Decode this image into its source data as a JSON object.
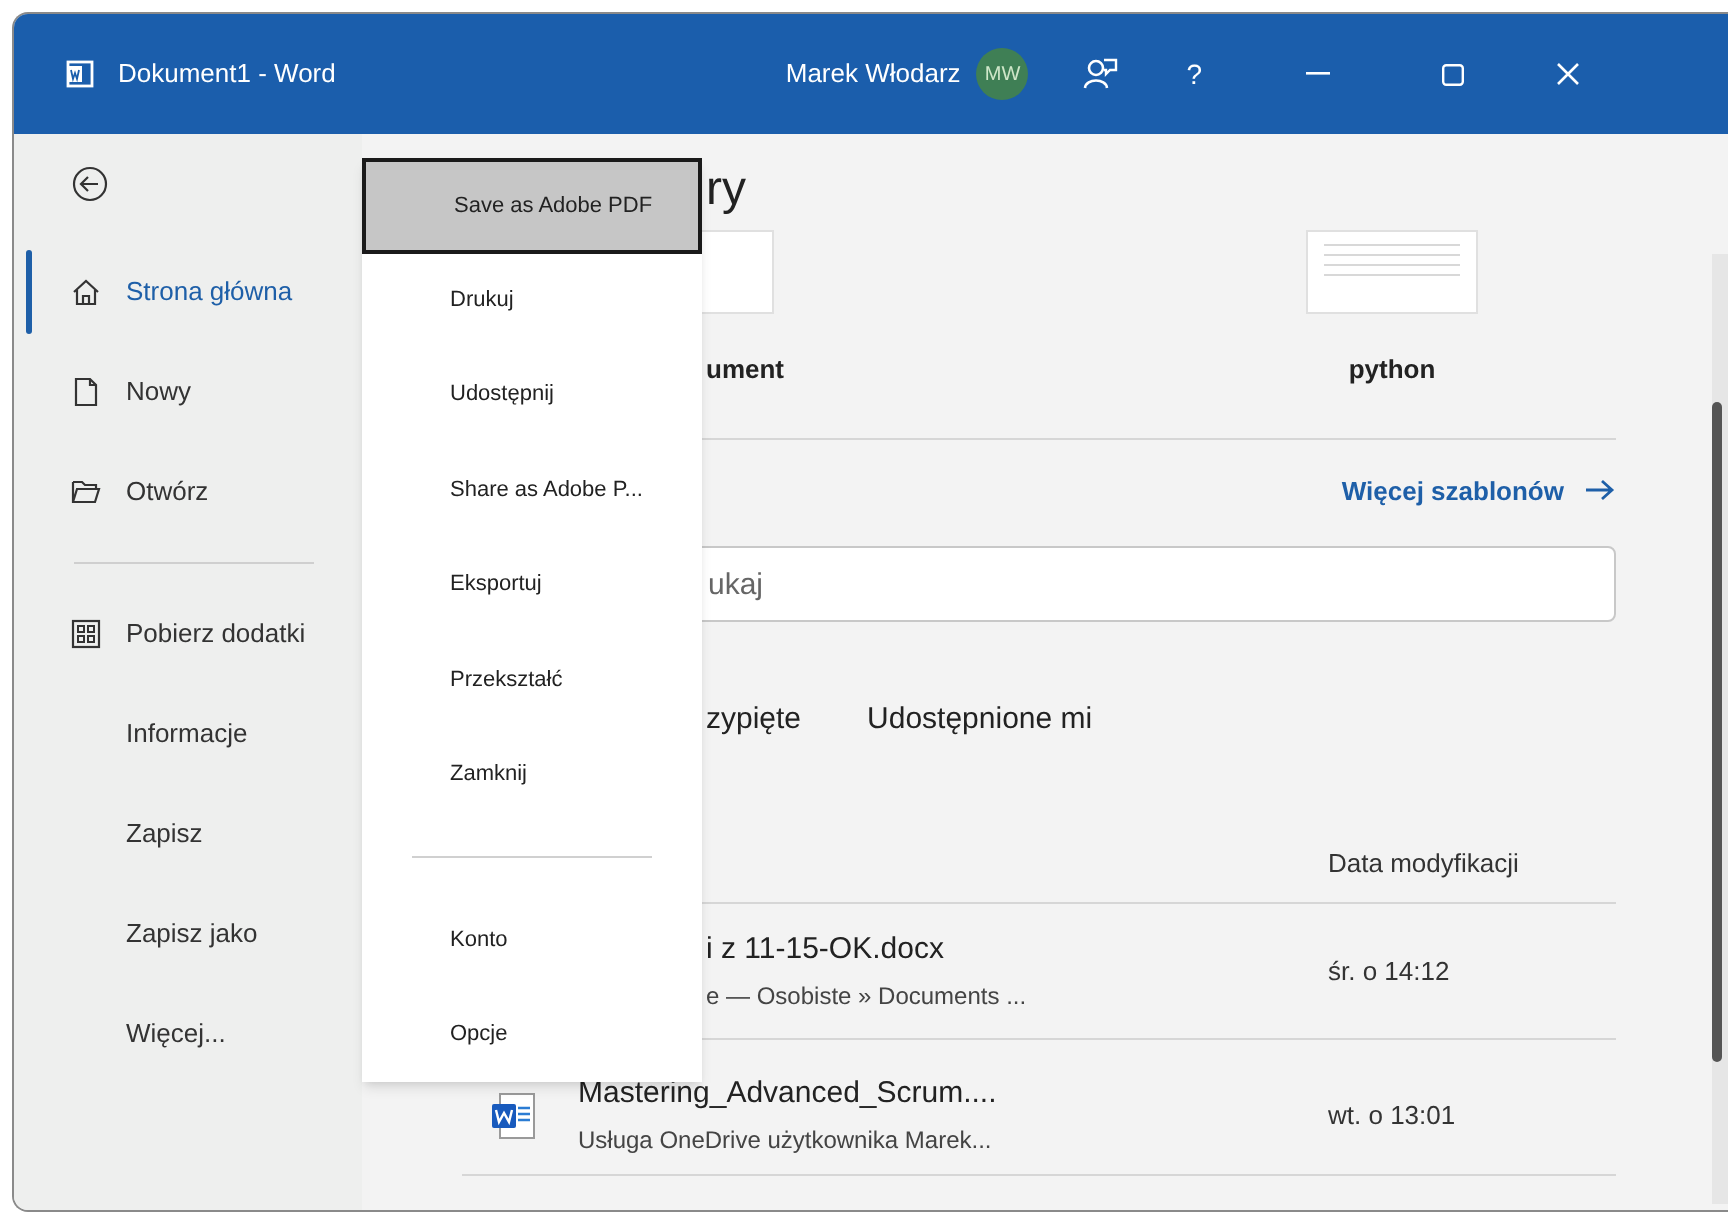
{
  "window": {
    "title": "Dokument1 - Word",
    "user": "Marek Włodarz",
    "avatar_initials": "MW",
    "help": "?"
  },
  "sidebar": {
    "items": [
      {
        "label": "Strona główna",
        "selected": true
      },
      {
        "label": "Nowy",
        "selected": false
      },
      {
        "label": "Otwórz",
        "selected": false
      },
      {
        "label": "Pobierz dodatki",
        "selected": false
      },
      {
        "label": "Informacje",
        "selected": false
      },
      {
        "label": "Zapisz",
        "selected": false
      },
      {
        "label": "Zapisz jako",
        "selected": false
      },
      {
        "label": "Więcej...",
        "selected": false
      }
    ]
  },
  "menu": {
    "groups": [
      [
        {
          "label": "Save as Adobe PDF",
          "selected": true
        },
        {
          "label": "Drukuj",
          "selected": false
        },
        {
          "label": "Udostępnij",
          "selected": false
        },
        {
          "label": "Share as Adobe P...",
          "selected": false
        },
        {
          "label": "Eksportuj",
          "selected": false
        },
        {
          "label": "Przekształć",
          "selected": false
        },
        {
          "label": "Zamknij",
          "selected": false
        }
      ],
      [
        {
          "label": "Konto",
          "selected": false
        },
        {
          "label": "Opcje",
          "selected": false
        }
      ]
    ]
  },
  "main": {
    "heading": "ry",
    "templates": [
      {
        "label": "ument"
      },
      {
        "label": "python"
      }
    ],
    "more_templates_link": "Więcej szablonów",
    "search": {
      "placeholder": "ukaj"
    },
    "tabs": [
      {
        "label": "zypięte"
      },
      {
        "label": "Udostępnione mi"
      }
    ],
    "files": {
      "date_column": "Data modyfikacji",
      "rows": [
        {
          "name": "i z 11-15-OK.docx",
          "location": "e — Osobiste » Documents ...",
          "modified": "śr. o 14:12"
        },
        {
          "name": "Mastering_Advanced_Scrum....",
          "location": "Usługa OneDrive użytkownika Marek...",
          "modified": "wt. o 13:01"
        }
      ]
    }
  }
}
